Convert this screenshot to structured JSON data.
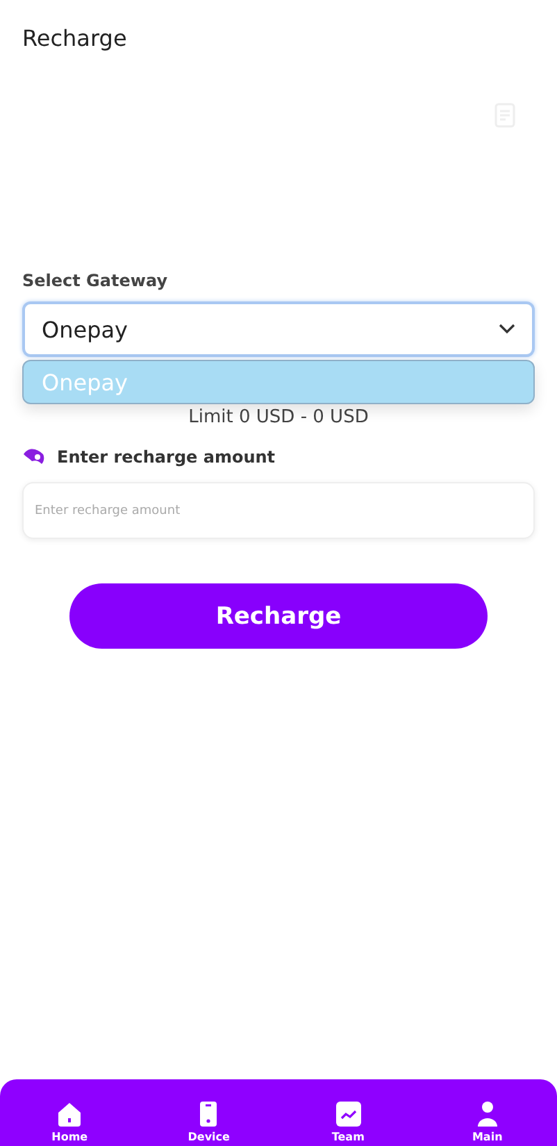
{
  "header": {
    "title": "Recharge"
  },
  "gateway": {
    "label": "Select Gateway",
    "value": "Onepay",
    "expanded": true,
    "options": [
      {
        "label": "Onepay",
        "selected": true
      }
    ]
  },
  "limit": "Limit 0 USD - 0 USD",
  "amount": {
    "label": "Enter recharge amount",
    "placeholder": "Enter recharge amount"
  },
  "submit": "Recharge",
  "nav": [
    {
      "label": "Home",
      "kind": "home"
    },
    {
      "label": "Device",
      "kind": "device"
    },
    {
      "label": "Team",
      "kind": "team"
    },
    {
      "label": "Main",
      "kind": "user"
    }
  ]
}
